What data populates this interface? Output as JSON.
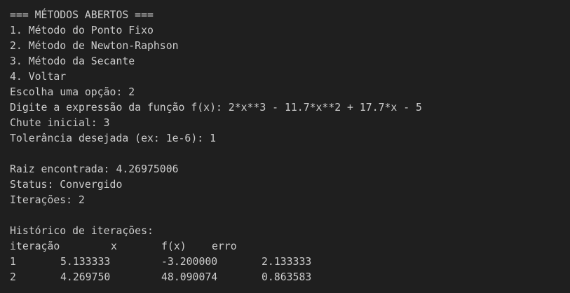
{
  "menu": {
    "header": "=== MÉTODOS ABERTOS ===",
    "options": [
      "1. Método do Ponto Fixo",
      "2. Método de Newton-Raphson",
      "3. Método da Secante",
      "4. Voltar"
    ]
  },
  "prompts": {
    "choice": "Escolha uma opção: 2",
    "function": "Digite a expressão da função f(x): 2*x**3 - 11.7*x**2 + 17.7*x - 5",
    "initial_guess": "Chute inicial: 3",
    "tolerance": "Tolerância desejada (ex: 1e-6): 1"
  },
  "result": {
    "root": "Raiz encontrada: 4.26975006",
    "status": "Status: Convergido",
    "iterations": "Iterações: 2"
  },
  "history": {
    "title": "Histórico de iterações:",
    "headers": [
      "iteração",
      "x",
      "f(x)",
      "erro"
    ],
    "rows": [
      [
        "1",
        "5.133333",
        "-3.200000",
        "2.133333"
      ],
      [
        "2",
        "4.269750",
        "48.090074",
        "0.863583"
      ]
    ]
  },
  "colors": {
    "background": "#1f1f1f",
    "text": "#cccccc"
  }
}
